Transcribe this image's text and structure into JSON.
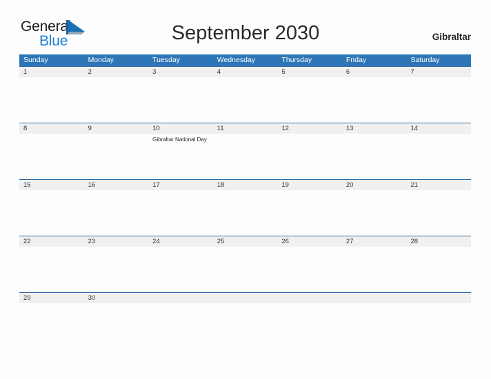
{
  "brand": {
    "name_part1": "General",
    "name_part2": "Blue",
    "flag_icon": "blue-triangle-flag-icon",
    "accent_color": "#1b7fd3"
  },
  "header": {
    "title": "September 2030",
    "locale": "Gibraltar"
  },
  "calendar": {
    "header_color": "#2e75b6",
    "band_color": "#f0f0f0",
    "rule_color": "#2e6da4",
    "weekdays": [
      "Sunday",
      "Monday",
      "Tuesday",
      "Wednesday",
      "Thursday",
      "Friday",
      "Saturday"
    ],
    "weeks": [
      {
        "days": [
          {
            "date": "1",
            "events": []
          },
          {
            "date": "2",
            "events": []
          },
          {
            "date": "3",
            "events": []
          },
          {
            "date": "4",
            "events": []
          },
          {
            "date": "5",
            "events": []
          },
          {
            "date": "6",
            "events": []
          },
          {
            "date": "7",
            "events": []
          }
        ]
      },
      {
        "days": [
          {
            "date": "8",
            "events": []
          },
          {
            "date": "9",
            "events": []
          },
          {
            "date": "10",
            "events": [
              "Gibraltar National Day"
            ]
          },
          {
            "date": "11",
            "events": []
          },
          {
            "date": "12",
            "events": []
          },
          {
            "date": "13",
            "events": []
          },
          {
            "date": "14",
            "events": []
          }
        ]
      },
      {
        "days": [
          {
            "date": "15",
            "events": []
          },
          {
            "date": "16",
            "events": []
          },
          {
            "date": "17",
            "events": []
          },
          {
            "date": "18",
            "events": []
          },
          {
            "date": "19",
            "events": []
          },
          {
            "date": "20",
            "events": []
          },
          {
            "date": "21",
            "events": []
          }
        ]
      },
      {
        "days": [
          {
            "date": "22",
            "events": []
          },
          {
            "date": "23",
            "events": []
          },
          {
            "date": "24",
            "events": []
          },
          {
            "date": "25",
            "events": []
          },
          {
            "date": "26",
            "events": []
          },
          {
            "date": "27",
            "events": []
          },
          {
            "date": "28",
            "events": []
          }
        ]
      },
      {
        "days": [
          {
            "date": "29",
            "events": []
          },
          {
            "date": "30",
            "events": []
          },
          {
            "date": "",
            "events": []
          },
          {
            "date": "",
            "events": []
          },
          {
            "date": "",
            "events": []
          },
          {
            "date": "",
            "events": []
          },
          {
            "date": "",
            "events": []
          }
        ]
      }
    ]
  }
}
